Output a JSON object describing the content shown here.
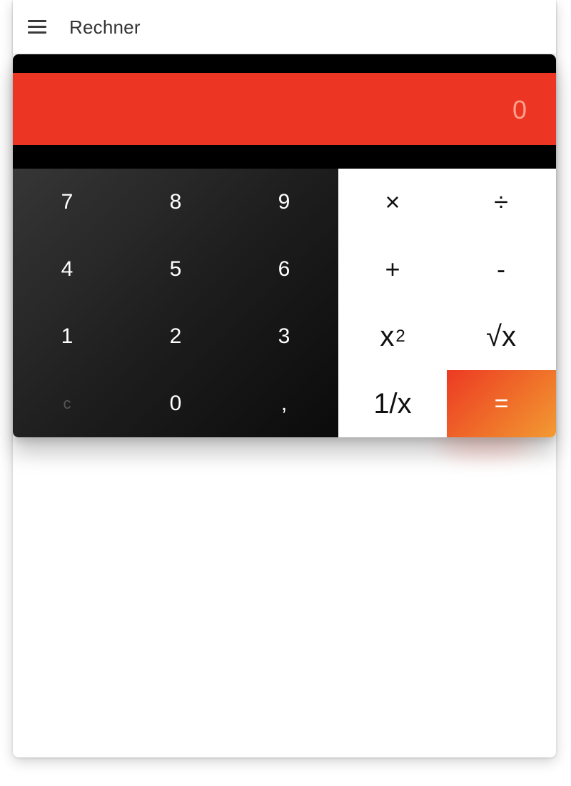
{
  "app": {
    "title": "Rechner",
    "menu_icon": "hamburger-menu-icon"
  },
  "display": {
    "value": "0"
  },
  "keys": {
    "numbers": {
      "seven": "7",
      "eight": "8",
      "nine": "9",
      "four": "4",
      "five": "5",
      "six": "6",
      "one": "1",
      "two": "2",
      "three": "3",
      "clear": "c",
      "zero": "0",
      "comma": ","
    },
    "operators": {
      "multiply": "×",
      "divide": "÷",
      "plus": "+",
      "minus": "-",
      "square_base": "x",
      "square_exp": "2",
      "sqrt": "√x",
      "reciprocal": "1/x",
      "equals": "="
    }
  },
  "colors": {
    "display_background": "#ec3523",
    "display_text": "#ffa08c",
    "numpad_background": "#1c1c1c",
    "operator_background": "#ffffff",
    "equals_gradient_start": "#ec3a24",
    "equals_gradient_end": "#f29a33"
  }
}
